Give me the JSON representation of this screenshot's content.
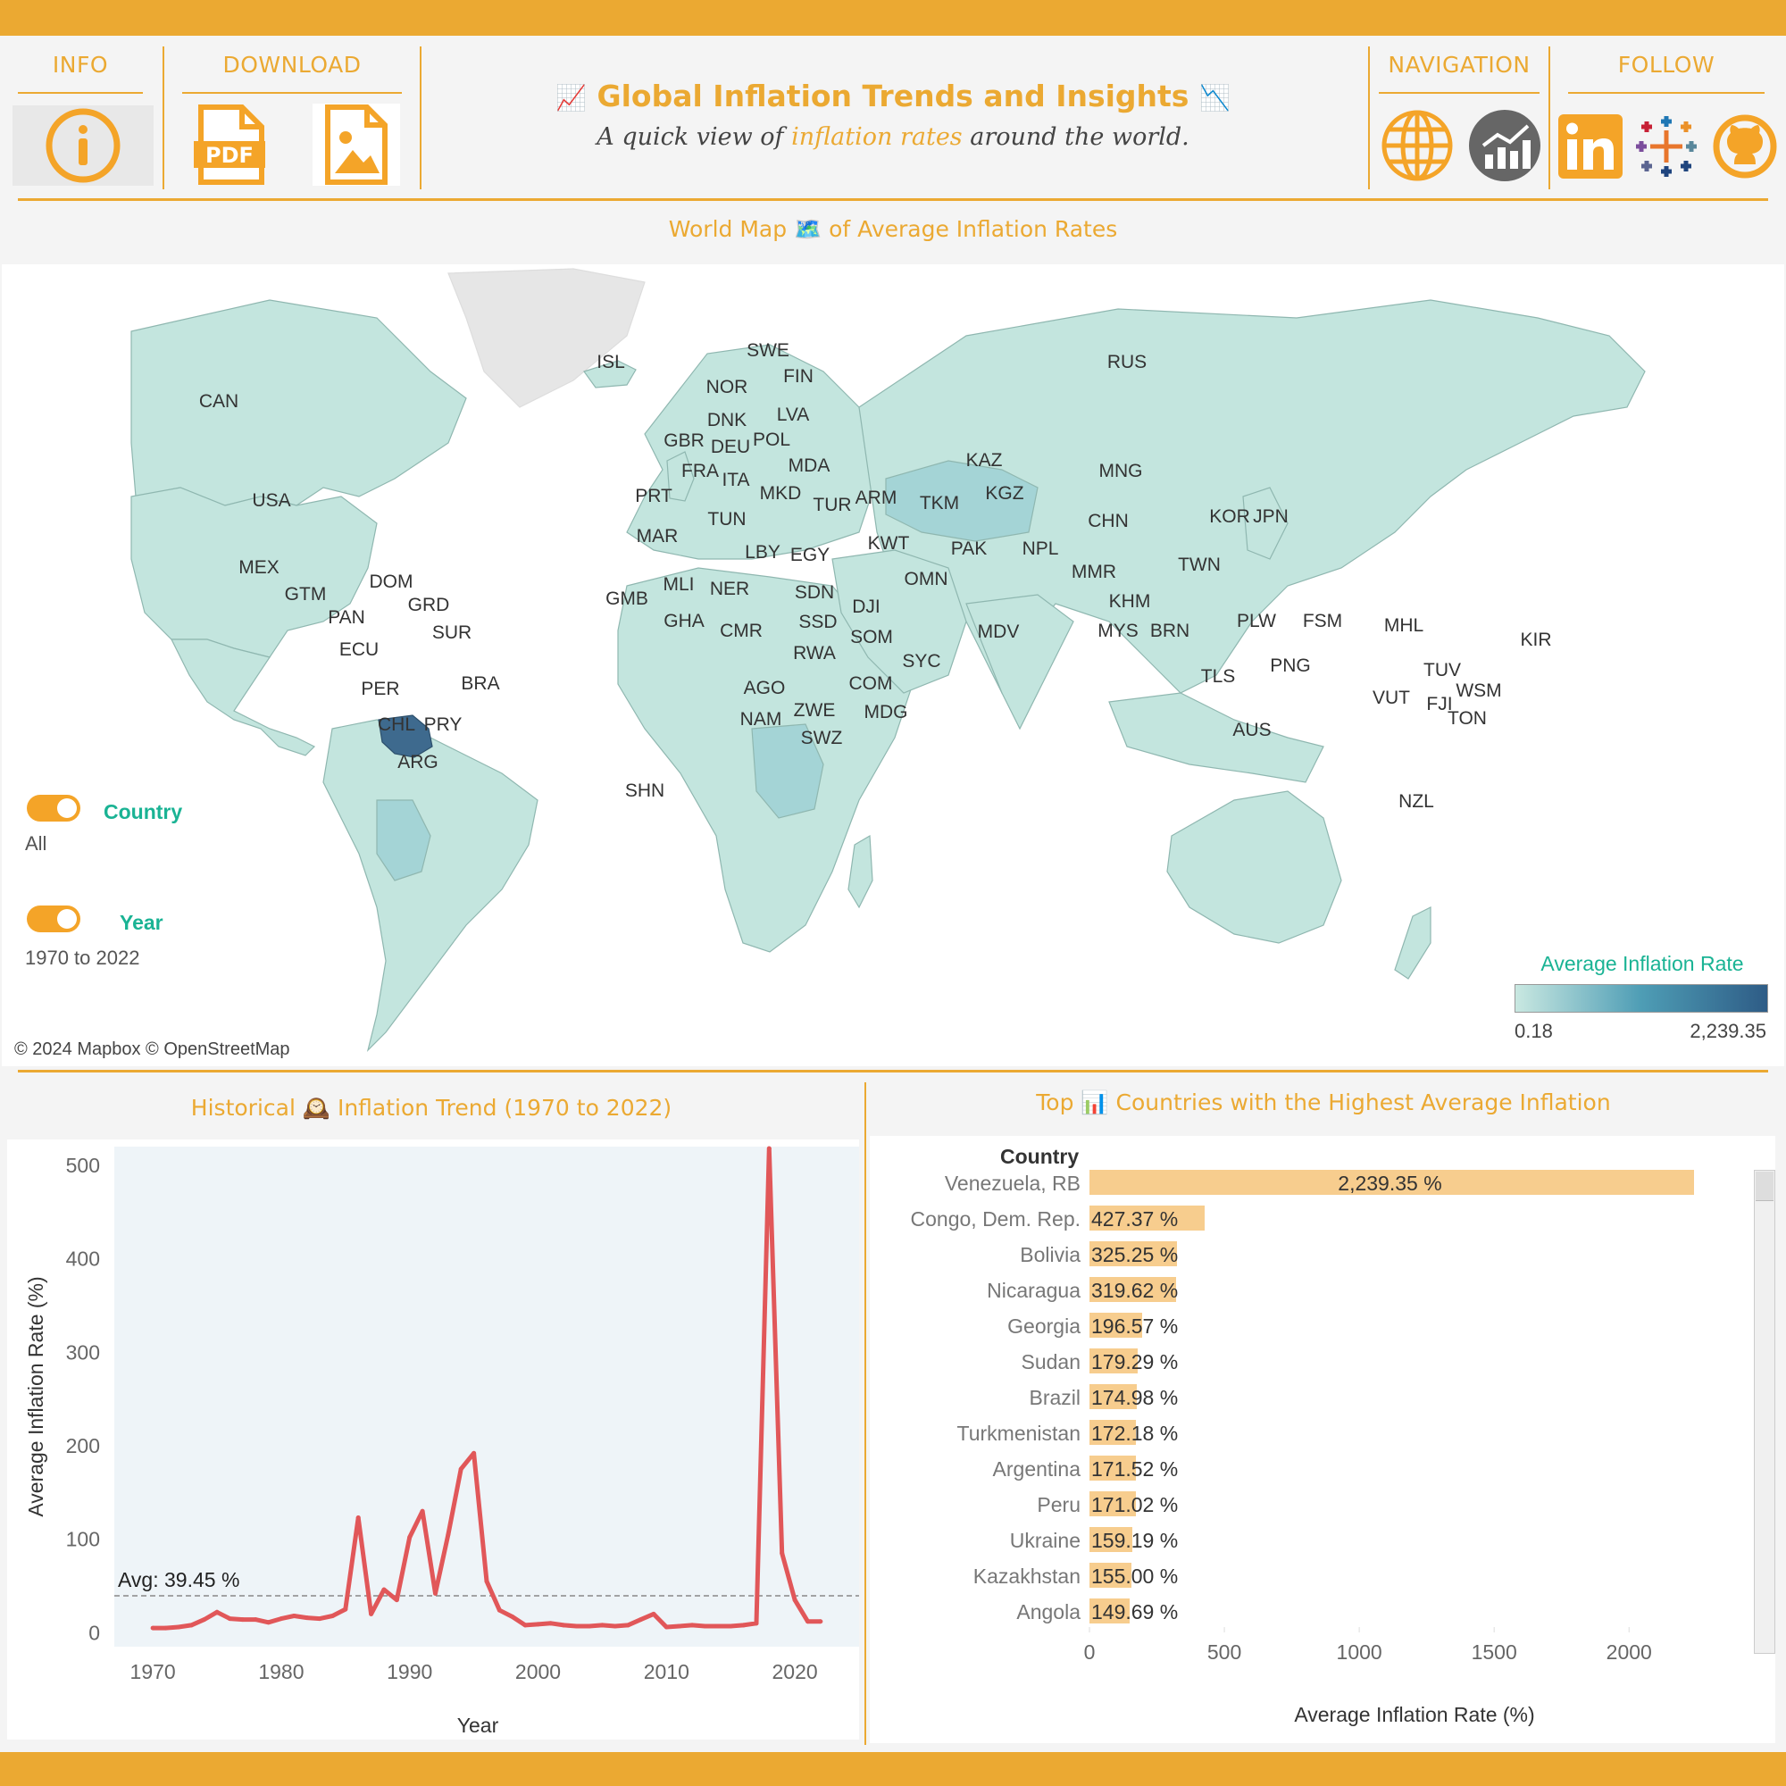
{
  "header": {
    "info_label": "INFO",
    "download_label": "DOWNLOAD",
    "navigation_label": "NAVIGATION",
    "follow_label": "FOLLOW",
    "title": "Global Inflation Trends and Insights",
    "subtitle_pre": "A quick view of",
    "subtitle_em": "inflation rates",
    "subtitle_post": "around the world.",
    "pdf_text": "PDF"
  },
  "map_section": {
    "title_pre": "World Map",
    "title_post": "of Average Inflation Rates",
    "attribution": "© 2024 Mapbox © OpenStreetMap",
    "legend_title": "Average Inflation Rate",
    "legend_min": "0.18",
    "legend_max": "2,239.35",
    "filters": {
      "country_label": "Country",
      "country_value": "All",
      "year_label": "Year",
      "year_value": "1970 to 2022"
    },
    "country_codes": [
      "CAN",
      "USA",
      "MEX",
      "GTM",
      "PAN",
      "DOM",
      "GRD",
      "SUR",
      "ECU",
      "PER",
      "BRA",
      "CHL",
      "PRY",
      "ARG",
      "SHN",
      "ISL",
      "SWE",
      "FIN",
      "NOR",
      "DNK",
      "LVA",
      "GBR",
      "DEU",
      "POL",
      "FRA",
      "MDA",
      "ITA",
      "PRT",
      "MKD",
      "TUR",
      "ARM",
      "TKM",
      "KAZ",
      "KGZ",
      "MNG",
      "RUS",
      "CHN",
      "KOR",
      "JPN",
      "TUN",
      "MAR",
      "LBY",
      "EGY",
      "KWT",
      "PAK",
      "NPL",
      "MMR",
      "TWN",
      "OMN",
      "GMB",
      "MLI",
      "NER",
      "SDN",
      "DJI",
      "GHA",
      "CMR",
      "SSD",
      "SOM",
      "RWA",
      "AGO",
      "COM",
      "ZWE",
      "NAM",
      "MDG",
      "SWZ",
      "SYC",
      "MDV",
      "KHM",
      "MYS",
      "BRN",
      "PLW",
      "FSM",
      "MHL",
      "KIR",
      "PNG",
      "TLS",
      "TUV",
      "VUT",
      "FJI",
      "WSM",
      "TON",
      "AUS",
      "NZL"
    ]
  },
  "trend_section": {
    "title_pre": "Historical",
    "title_post": "Inflation Trend (1970 to 2022)",
    "avg_label": "Avg: 39.45 %"
  },
  "top_section": {
    "title_pre": "Top",
    "title_post": "Countries with the Highest Average Inflation",
    "column_header": "Country"
  },
  "chart_data": [
    {
      "type": "line",
      "title": "Historical Inflation Trend (1970 to 2022)",
      "xlabel": "Year",
      "ylabel": "Average Inflation Rate (%)",
      "xlim": [
        1967,
        2025
      ],
      "ylim": [
        0,
        520
      ],
      "xticks": [
        1970,
        1980,
        1990,
        2000,
        2010,
        2020
      ],
      "yticks": [
        0,
        100,
        200,
        300,
        400,
        500
      ],
      "reference_line": {
        "value": 39.45,
        "label": "Avg: 39.45 %"
      },
      "color": "#E15759",
      "x": [
        1970,
        1971,
        1972,
        1973,
        1974,
        1975,
        1976,
        1977,
        1978,
        1979,
        1980,
        1981,
        1982,
        1983,
        1984,
        1985,
        1986,
        1987,
        1988,
        1989,
        1990,
        1991,
        1992,
        1993,
        1994,
        1995,
        1996,
        1997,
        1998,
        1999,
        2000,
        2001,
        2002,
        2003,
        2004,
        2005,
        2006,
        2007,
        2008,
        2009,
        2010,
        2011,
        2012,
        2013,
        2014,
        2015,
        2016,
        2017,
        2018,
        2019,
        2020,
        2021,
        2022
      ],
      "y": [
        5,
        5,
        6,
        8,
        14,
        22,
        15,
        14,
        14,
        11,
        15,
        18,
        16,
        15,
        18,
        25,
        123,
        20,
        46,
        35,
        102,
        130,
        42,
        105,
        175,
        192,
        55,
        24,
        17,
        8,
        9,
        10,
        8,
        7,
        7,
        8,
        7,
        8,
        14,
        20,
        6,
        7,
        8,
        7,
        7,
        7,
        8,
        10,
        518,
        85,
        35,
        12,
        12
      ]
    },
    {
      "type": "bar",
      "orientation": "horizontal",
      "xlabel": "Average Inflation Rate (%)",
      "ylabel": "Country",
      "xlim": [
        0,
        2350
      ],
      "xticks": [
        0,
        500,
        1000,
        1500,
        2000
      ],
      "categories": [
        "Venezuela, RB",
        "Congo, Dem. Rep.",
        "Bolivia",
        "Nicaragua",
        "Georgia",
        "Sudan",
        "Brazil",
        "Turkmenistan",
        "Argentina",
        "Peru",
        "Ukraine",
        "Kazakhstan",
        "Angola"
      ],
      "values": [
        2239.35,
        427.37,
        325.25,
        319.62,
        196.57,
        179.29,
        174.98,
        172.18,
        171.52,
        171.02,
        159.19,
        155.0,
        149.69
      ],
      "labels": [
        "2,239.35 %",
        "427.37 %",
        "325.25 %",
        "319.62 %",
        "196.57 %",
        "179.29 %",
        "174.98 %",
        "172.18 %",
        "171.52 %",
        "171.02 %",
        "159.19 %",
        "155.00 %",
        "149.69 %"
      ]
    }
  ]
}
